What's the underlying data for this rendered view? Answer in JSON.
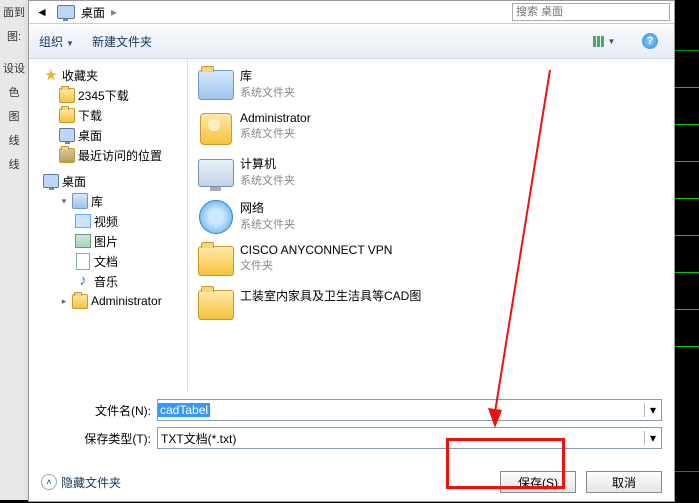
{
  "addressbar": {
    "location": "桌面",
    "chev": "▸",
    "search_placeholder": "搜索 桌面"
  },
  "toolbar": {
    "organize": "组织",
    "newfolder": "新建文件夹"
  },
  "nav": {
    "fav": {
      "label": "收藏夹",
      "items": [
        "2345下载",
        "下载",
        "桌面",
        "最近访问的位置"
      ]
    },
    "desktop": {
      "label": "桌面",
      "lib": {
        "label": "库",
        "items": [
          "视频",
          "图片",
          "文档",
          "音乐"
        ]
      },
      "admin": "Administrator"
    }
  },
  "list": {
    "items": [
      {
        "title": "库",
        "sub": "系统文件夹",
        "kind": "lib"
      },
      {
        "title": "Administrator",
        "sub": "系统文件夹",
        "kind": "user"
      },
      {
        "title": "计算机",
        "sub": "系统文件夹",
        "kind": "computer"
      },
      {
        "title": "网络",
        "sub": "系统文件夹",
        "kind": "net"
      },
      {
        "title": "CISCO ANYCONNECT VPN",
        "sub": "文件夹",
        "kind": "folder"
      },
      {
        "title": "工装室内家具及卫生洁具等CAD图",
        "sub": "",
        "kind": "folder"
      }
    ]
  },
  "form": {
    "filename_label": "文件名(N):",
    "filename_value": "cadTabel",
    "savetype_label": "保存类型(T):",
    "savetype_value": "TXT文档(*.txt)"
  },
  "footer": {
    "hide": "隐藏文件夹",
    "save": "保存(S)",
    "cancel": "取消"
  },
  "leftpanel": [
    "面到",
    " ",
    "图:",
    " ",
    "设设",
    "色",
    "图",
    "线",
    "线"
  ]
}
